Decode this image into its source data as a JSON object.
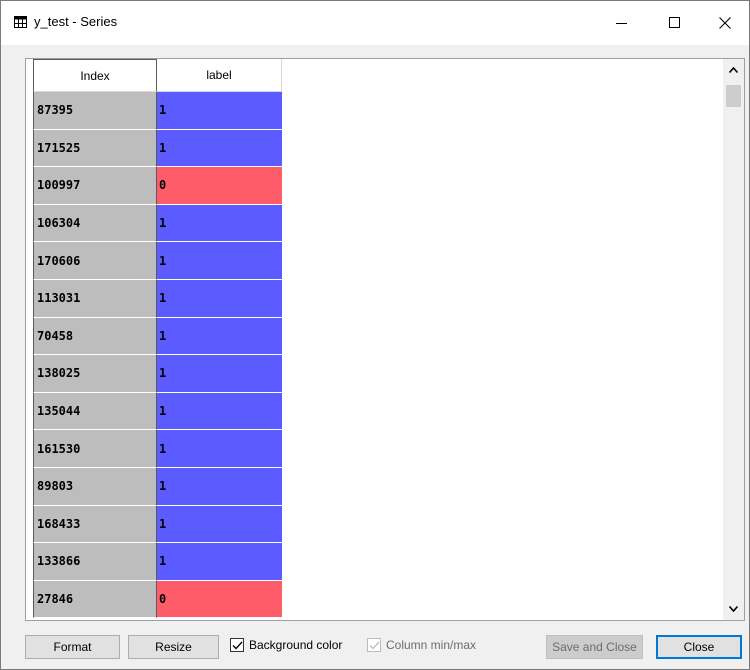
{
  "window": {
    "title": "y_test - Series",
    "icon": "table-grid-icon"
  },
  "table": {
    "columns": [
      "Index",
      "label"
    ],
    "rows": [
      {
        "index": "87395",
        "label": "1"
      },
      {
        "index": "171525",
        "label": "1"
      },
      {
        "index": "100997",
        "label": "0"
      },
      {
        "index": "106304",
        "label": "1"
      },
      {
        "index": "170606",
        "label": "1"
      },
      {
        "index": "113031",
        "label": "1"
      },
      {
        "index": "70458",
        "label": "1"
      },
      {
        "index": "138025",
        "label": "1"
      },
      {
        "index": "135044",
        "label": "1"
      },
      {
        "index": "161530",
        "label": "1"
      },
      {
        "index": "89803",
        "label": "1"
      },
      {
        "index": "168433",
        "label": "1"
      },
      {
        "index": "133866",
        "label": "1"
      },
      {
        "index": "27846",
        "label": "0"
      }
    ],
    "colors": {
      "value_1": "#5b5bff",
      "value_0": "#ff5c6a",
      "index_bg": "#bdbdbd"
    }
  },
  "buttons": {
    "format": "Format",
    "resize": "Resize",
    "save_and_close": "Save and Close",
    "close": "Close"
  },
  "checkboxes": {
    "background_color": {
      "label": "Background color",
      "checked": true
    },
    "column_minmax": {
      "label": "Column min/max",
      "checked": true,
      "enabled": false
    }
  },
  "accent_color": "#0078d7"
}
